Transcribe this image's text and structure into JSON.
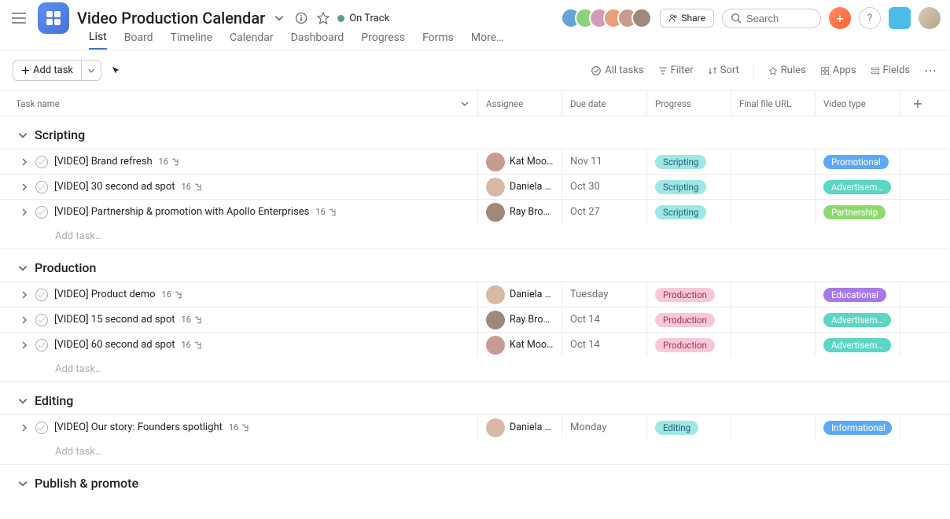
{
  "header": {
    "project_title": "Video Production Calendar",
    "status": "On Track",
    "share_label": "Share",
    "search_placeholder": "Search"
  },
  "tabs": [
    "List",
    "Board",
    "Timeline",
    "Calendar",
    "Dashboard",
    "Progress",
    "Forms",
    "More…"
  ],
  "active_tab": 0,
  "toolbar": {
    "add_task_label": "Add task",
    "all_tasks": "All tasks",
    "filter": "Filter",
    "sort": "Sort",
    "rules": "Rules",
    "apps": "Apps",
    "fields": "Fields"
  },
  "columns": {
    "task": "Task name",
    "assignee": "Assignee",
    "due": "Due date",
    "progress": "Progress",
    "final_url": "Final file URL",
    "video_type": "Video type"
  },
  "colors": {
    "scripting": {
      "bg": "#9ee7e3",
      "fg": "#1e617a"
    },
    "production": {
      "bg": "#f8c8d6",
      "fg": "#9a355f"
    },
    "editing": {
      "bg": "#9ee7e3",
      "fg": "#1e617a"
    },
    "promotional": {
      "bg": "#5da9f5",
      "fg": "#ffffff"
    },
    "advertisement": {
      "bg": "#5bd6c3",
      "fg": "#ffffff"
    },
    "partnership": {
      "bg": "#8ed96e",
      "fg": "#ffffff"
    },
    "educational": {
      "bg": "#a878e8",
      "fg": "#ffffff"
    },
    "informational": {
      "bg": "#5da9f5",
      "fg": "#ffffff"
    }
  },
  "assignee_colors": {
    "Kat Mooney": "#c99b8e",
    "Daniela Var…": "#d9b9a3",
    "Ray Brooks": "#a0887a"
  },
  "add_task_placeholder": "Add task…",
  "sections": [
    {
      "title": "Scripting",
      "tasks": [
        {
          "name": "[VIDEO] Brand refresh",
          "subtasks": 16,
          "assignee": "Kat Mooney",
          "due": "Nov 11",
          "progress": "Scripting",
          "progress_color": "scripting",
          "video_type": "Promotional",
          "type_color": "promotional"
        },
        {
          "name": "[VIDEO] 30 second ad spot",
          "subtasks": 16,
          "assignee": "Daniela Var…",
          "due": "Oct 30",
          "progress": "Scripting",
          "progress_color": "scripting",
          "video_type": "Advertisem…",
          "type_color": "advertisement"
        },
        {
          "name": "[VIDEO] Partnership & promotion with Apollo Enterprises",
          "subtasks": 16,
          "assignee": "Ray Brooks",
          "due": "Oct 27",
          "progress": "Scripting",
          "progress_color": "scripting",
          "video_type": "Partnership",
          "type_color": "partnership"
        }
      ]
    },
    {
      "title": "Production",
      "tasks": [
        {
          "name": "[VIDEO] Product demo",
          "subtasks": 16,
          "assignee": "Daniela Var…",
          "due": "Tuesday",
          "progress": "Production",
          "progress_color": "production",
          "video_type": "Educational",
          "type_color": "educational"
        },
        {
          "name": "[VIDEO] 15 second ad spot",
          "subtasks": 16,
          "assignee": "Ray Brooks",
          "due": "Oct 14",
          "progress": "Production",
          "progress_color": "production",
          "video_type": "Advertisem…",
          "type_color": "advertisement"
        },
        {
          "name": "[VIDEO] 60 second ad spot",
          "subtasks": 16,
          "assignee": "Kat Mooney",
          "due": "Oct 14",
          "progress": "Production",
          "progress_color": "production",
          "video_type": "Advertisem…",
          "type_color": "advertisement"
        }
      ]
    },
    {
      "title": "Editing",
      "tasks": [
        {
          "name": "[VIDEO] Our story: Founders spotlight",
          "subtasks": 16,
          "assignee": "Daniela Var…",
          "due": "Monday",
          "progress": "Editing",
          "progress_color": "editing",
          "video_type": "Informational",
          "type_color": "informational"
        }
      ]
    },
    {
      "title": "Publish & promote",
      "tasks": []
    }
  ]
}
